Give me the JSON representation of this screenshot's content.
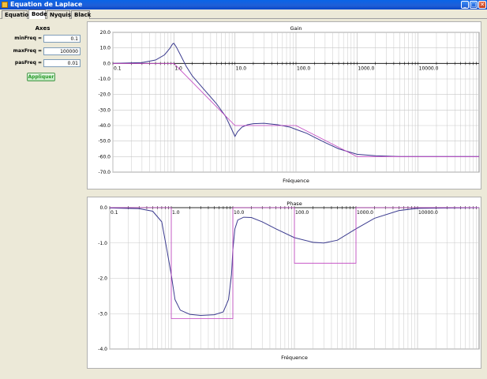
{
  "window": {
    "title": "Equation de Laplace",
    "minimize": "_",
    "maximize": "□",
    "close": "✕"
  },
  "tabs": [
    {
      "label": "Equation"
    },
    {
      "label": "Bode",
      "active": true
    },
    {
      "label": "Nyquist"
    },
    {
      "label": "Black"
    }
  ],
  "sidebar": {
    "title": "Axes",
    "fields": [
      {
        "label": "minFreq =",
        "value": "0.1"
      },
      {
        "label": "maxFreq =",
        "value": "100000"
      },
      {
        "label": "pasFreq =",
        "value": "0.01"
      }
    ],
    "apply_label": "Appliquer"
  },
  "colors": {
    "curve": "#3b3b8f",
    "asymptote": "#c040c0",
    "grid": "#c8c8c8",
    "apply_text": "#2a9a2a"
  },
  "chart_data": [
    {
      "type": "line",
      "title": "Gain",
      "xlabel": "Fréquence",
      "xscale": "log",
      "xlim": [
        0.1,
        100000
      ],
      "ylim": [
        -70,
        20
      ],
      "yticks": [
        "20.0",
        "10.0",
        "0.0",
        "-10.0",
        "-20.0",
        "-30.0",
        "-40.0",
        "-50.0",
        "-60.0",
        "-70.0"
      ],
      "xticks": [
        "0.1",
        "1.0",
        "10.0",
        "100.0",
        "1000.0",
        "10000.0"
      ],
      "grid": true,
      "series": [
        {
          "role": "curve",
          "x": [
            0.1,
            0.3,
            0.5,
            0.7,
            0.85,
            0.95,
            1.0,
            1.1,
            1.3,
            1.6,
            2,
            3,
            5,
            7,
            9,
            10,
            11,
            13,
            16,
            20,
            30,
            50,
            80,
            100,
            150,
            200,
            300,
            500,
            1000,
            2000,
            5000,
            10000,
            100000
          ],
          "y": [
            0,
            0.6,
            2.2,
            5.5,
            9.5,
            12.5,
            13,
            10.5,
            5,
            -2,
            -8,
            -16,
            -26,
            -34,
            -43,
            -47,
            -44,
            -41,
            -39.5,
            -38.8,
            -38.5,
            -39.5,
            -41,
            -42.5,
            -45,
            -47.5,
            -51,
            -55,
            -58.5,
            -59.5,
            -60,
            -60,
            -60
          ]
        },
        {
          "role": "asymptote",
          "x": [
            0.1,
            1,
            10,
            100,
            1000,
            100000
          ],
          "y": [
            0,
            0,
            -40,
            -40,
            -60,
            -60
          ]
        }
      ]
    },
    {
      "type": "line",
      "title": "Phase",
      "xlabel": "Fréquence",
      "xscale": "log",
      "xlim": [
        0.1,
        100000
      ],
      "ylim": [
        -4,
        0
      ],
      "yticks": [
        "0.0",
        "-1.0",
        "-2.0",
        "-3.0",
        "-4.0"
      ],
      "xticks": [
        "0.1",
        "1.0",
        "10.0",
        "100.0",
        "1000.0",
        "10000.0"
      ],
      "grid": true,
      "series": [
        {
          "role": "curve",
          "x": [
            0.1,
            0.3,
            0.5,
            0.7,
            0.85,
            1.0,
            1.15,
            1.4,
            2,
            3,
            5,
            7,
            8.5,
            9.5,
            10,
            10.8,
            12,
            15,
            20,
            30,
            50,
            100,
            200,
            300,
            500,
            1000,
            2000,
            5000,
            10000,
            100000
          ],
          "y": [
            -0.01,
            -0.03,
            -0.1,
            -0.4,
            -1.2,
            -1.9,
            -2.6,
            -2.9,
            -3.02,
            -3.05,
            -3.03,
            -2.95,
            -2.6,
            -1.9,
            -1.2,
            -0.6,
            -0.35,
            -0.27,
            -0.28,
            -0.4,
            -0.6,
            -0.85,
            -0.98,
            -1.0,
            -0.92,
            -0.6,
            -0.3,
            -0.08,
            -0.02,
            0
          ]
        },
        {
          "role": "asymptote",
          "x": [
            0.1,
            1,
            1,
            10,
            10,
            100,
            100,
            1000,
            1000,
            100000
          ],
          "y": [
            0,
            0,
            -3.14,
            -3.14,
            0,
            0,
            -1.57,
            -1.57,
            0,
            0
          ]
        }
      ]
    }
  ]
}
